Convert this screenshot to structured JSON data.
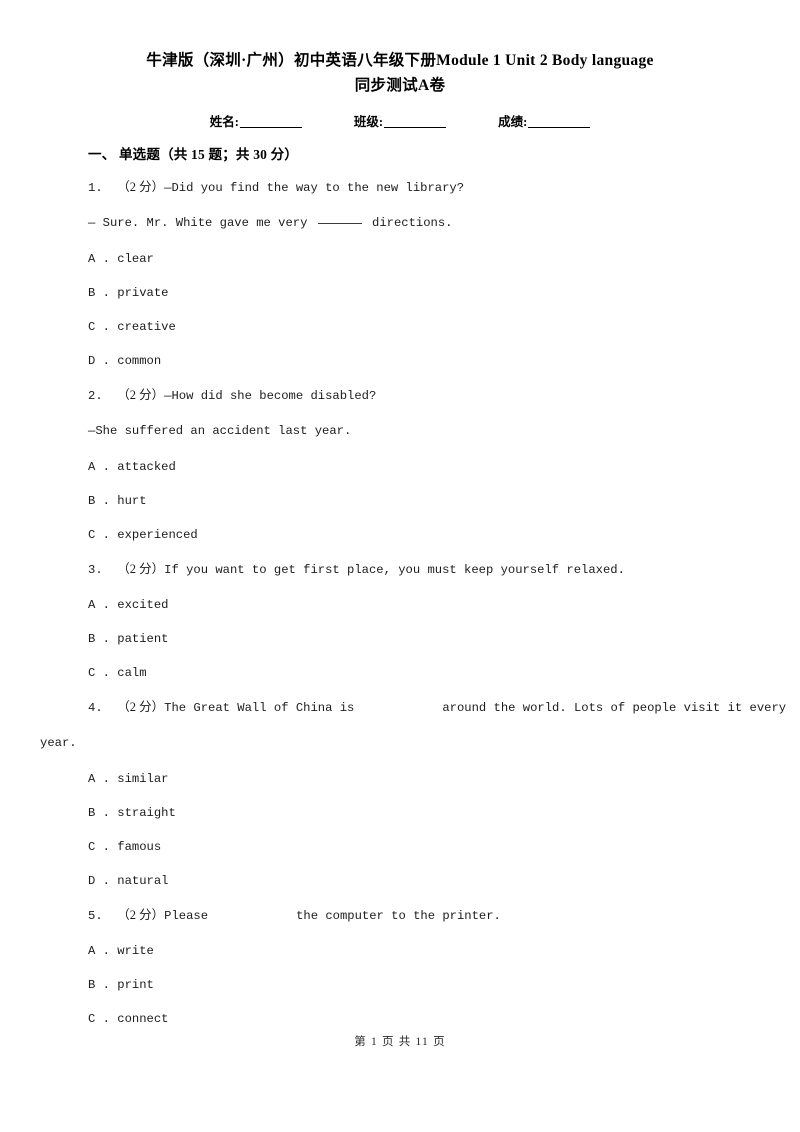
{
  "document": {
    "title_line1": "牛津版（深圳·广州）初中英语八年级下册Module 1 Unit 2 Body language",
    "title_line2": "同步测试A卷"
  },
  "identity": {
    "name_label": "姓名:",
    "class_label": "班级:",
    "score_label": "成绩:"
  },
  "section": {
    "heading": "一、 单选题（共 15 题；共 30 分）"
  },
  "questions": [
    {
      "number": "1.",
      "points": "（2 分）",
      "stem_part1": "—Did you find the way to the new library?",
      "stem_line2_pre": "— Sure. Mr. White gave me very ",
      "stem_line2_post": " directions.",
      "options": [
        {
          "letter": "A .",
          "text": "clear"
        },
        {
          "letter": "B .",
          "text": "private"
        },
        {
          "letter": "C .",
          "text": "creative"
        },
        {
          "letter": "D .",
          "text": "common"
        }
      ]
    },
    {
      "number": "2.",
      "points": "（2 分）",
      "stem_part1": "—How did she become disabled?",
      "stem_line2": "—She suffered an accident last year.",
      "options": [
        {
          "letter": "A .",
          "text": "attacked"
        },
        {
          "letter": "B .",
          "text": "hurt"
        },
        {
          "letter": "C .",
          "text": "experienced"
        }
      ]
    },
    {
      "number": "3.",
      "points": "（2 分）",
      "stem_part1": "If you want to get first place, you must keep yourself relaxed.",
      "options": [
        {
          "letter": "A .",
          "text": "excited"
        },
        {
          "letter": "B .",
          "text": "patient"
        },
        {
          "letter": "C .",
          "text": "calm"
        }
      ]
    },
    {
      "number": "4.",
      "points": "（2 分）",
      "stem_pre": "The Great Wall of China is",
      "stem_post": "around the world. Lots of people visit it every",
      "stem_wrap": "year.",
      "options": [
        {
          "letter": "A .",
          "text": "similar"
        },
        {
          "letter": "B .",
          "text": "straight"
        },
        {
          "letter": "C .",
          "text": "famous"
        },
        {
          "letter": "D .",
          "text": "natural"
        }
      ]
    },
    {
      "number": "5.",
      "points": "（2 分）",
      "stem_pre": "Please",
      "stem_post": "the computer to the printer.",
      "options": [
        {
          "letter": "A .",
          "text": "write"
        },
        {
          "letter": "B .",
          "text": "print"
        },
        {
          "letter": "C .",
          "text": "connect"
        }
      ]
    }
  ],
  "footer": {
    "page_indicator": "第 1 页 共 11 页"
  }
}
